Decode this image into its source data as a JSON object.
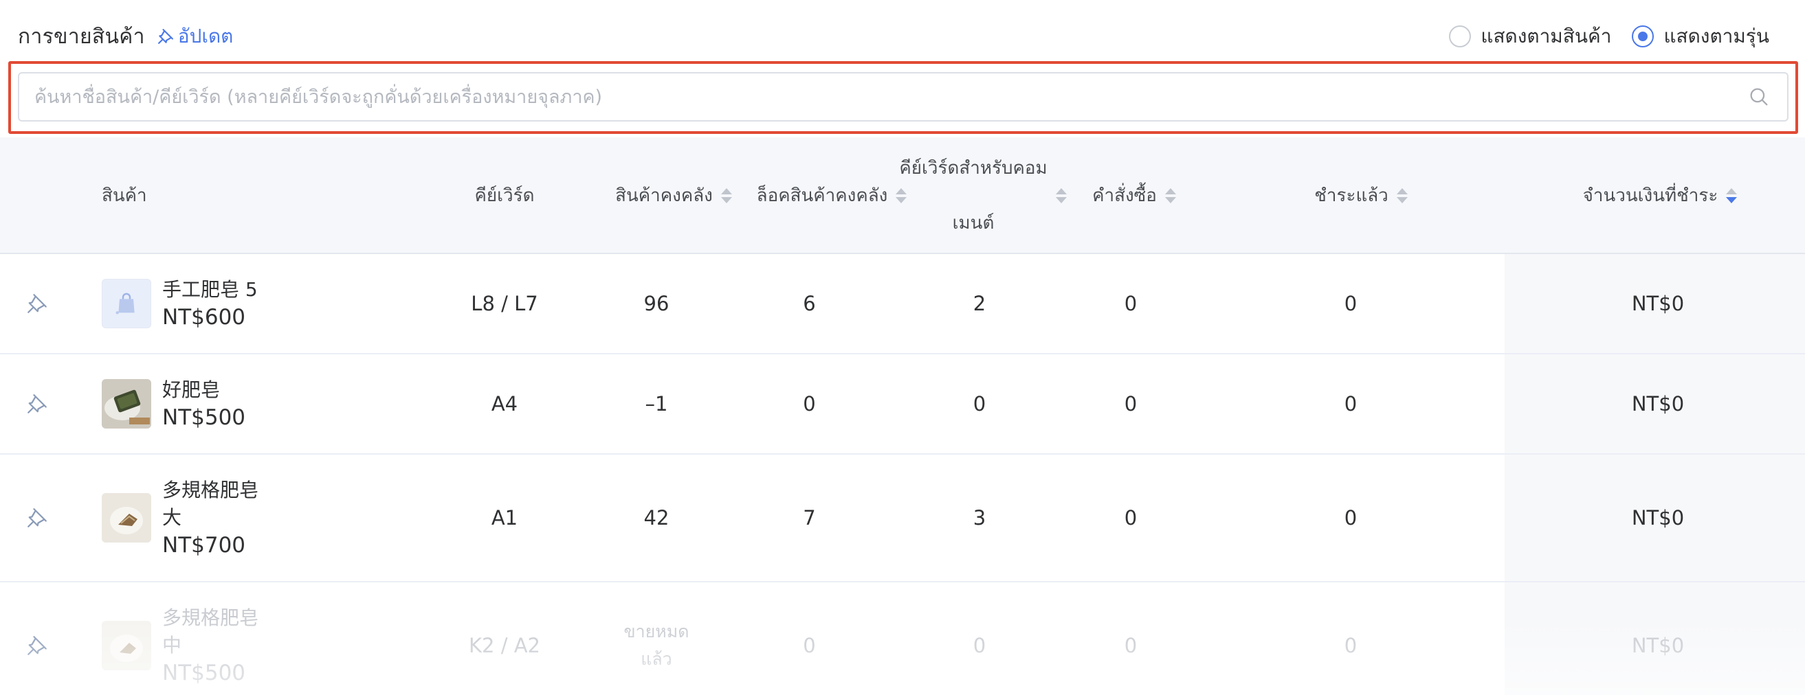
{
  "header": {
    "title": "การขายสินค้า",
    "update_label": "อัปเดต"
  },
  "view_options": [
    {
      "label": "แสดงตามสินค้า",
      "checked": false
    },
    {
      "label": "แสดงตามรุ่น",
      "checked": true
    }
  ],
  "search": {
    "placeholder": "ค้นหาชื่อสินค้า/คีย์เวิร์ด (หลายคีย์เวิร์ดจะถูกคั่นด้วยเครื่องหมายจุลภาค)",
    "value": ""
  },
  "table": {
    "columns": {
      "product": "สินค้า",
      "keyword": "คีย์เวิร์ด",
      "stock": "สินค้าคงคลัง",
      "locked_stock": "ล็อคสินค้าคงคลัง",
      "comment_keyword_line1": "คีย์เวิร์ดสำหรับคอม",
      "comment_keyword_line2": "เมนต์",
      "orders": "คำสั่งซื้อ",
      "paid": "ชำระแล้ว",
      "amount_paid": "จำนวนเงินที่ชำระ"
    },
    "rows": [
      {
        "name": "手工肥皂 5",
        "price": "NT$600",
        "keyword": "L8 / L7",
        "stock": "96",
        "locked_stock": "6",
        "comment_keyword": "2",
        "orders": "0",
        "paid": "0",
        "amount": "NT$0"
      },
      {
        "name": "好肥皂",
        "price": "NT$500",
        "keyword": "A4",
        "stock": "–1",
        "locked_stock": "0",
        "comment_keyword": "0",
        "orders": "0",
        "paid": "0",
        "amount": "NT$0"
      },
      {
        "name_line1": "多規格肥皂",
        "name_line2": "大",
        "price": "NT$700",
        "keyword": "A1",
        "stock": "42",
        "locked_stock": "7",
        "comment_keyword": "3",
        "orders": "0",
        "paid": "0",
        "amount": "NT$0"
      },
      {
        "name_line1": "多規格肥皂",
        "name_line2": "中",
        "price": "NT$500",
        "keyword": "K2 / A2",
        "stock_line1": "ขายหมด",
        "stock_line2": "แล้ว",
        "locked_stock": "0",
        "comment_keyword": "0",
        "orders": "0",
        "paid": "0",
        "amount": "NT$0"
      }
    ]
  },
  "colors": {
    "accent": "#4a78e8",
    "highlight_border": "#e14a34",
    "header_bg": "#f5f7fa",
    "disabled_text": "#c8cbd0"
  },
  "icons": [
    "pin-icon",
    "search-icon",
    "shopping-bag-icon"
  ]
}
